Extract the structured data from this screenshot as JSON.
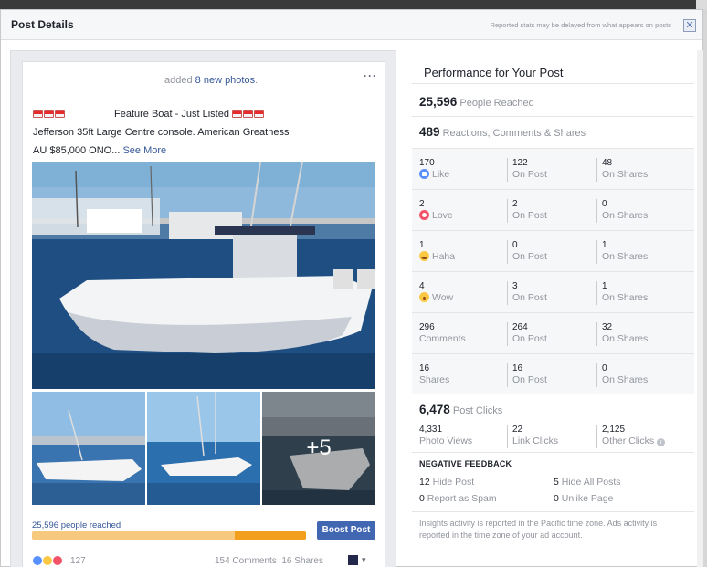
{
  "dialog": {
    "title": "Post Details",
    "header_note": "Reported stats may be delayed from what appears on posts",
    "close_glyph": "✕"
  },
  "post": {
    "added_prefix": "added ",
    "added_link": "8 new photos",
    "added_suffix": ".",
    "more_glyph": "···",
    "headline": "Feature Boat - Just Listed",
    "description": "Jefferson 35ft Large Centre console. American Greatness",
    "price": "AU $85,000 ONO",
    "ellipsis": "...",
    "see_more": "See More",
    "extra_photos": "+5",
    "reach_text": "25,596 people reached",
    "reach_fraction": 0.74,
    "boost_label": "Boost Post",
    "reactions_count": "127",
    "comments": "154 Comments",
    "shares": "16 Shares",
    "dropdown_glyph": "▾"
  },
  "performance": {
    "title": "Performance for Your Post",
    "reached_value": "25,596",
    "reached_label": "People Reached",
    "engagement_value": "489",
    "engagement_label": "Reactions, Comments & Shares",
    "rows": [
      {
        "total": "170",
        "label": "Like",
        "icon": "like",
        "on_post": "122",
        "on_post_label": "On Post",
        "on_shares": "48",
        "on_shares_label": "On Shares"
      },
      {
        "total": "2",
        "label": "Love",
        "icon": "love",
        "on_post": "2",
        "on_post_label": "On Post",
        "on_shares": "0",
        "on_shares_label": "On Shares"
      },
      {
        "total": "1",
        "label": "Haha",
        "icon": "haha",
        "on_post": "0",
        "on_post_label": "On Post",
        "on_shares": "1",
        "on_shares_label": "On Shares"
      },
      {
        "total": "4",
        "label": "Wow",
        "icon": "wow",
        "on_post": "3",
        "on_post_label": "On Post",
        "on_shares": "1",
        "on_shares_label": "On Shares"
      },
      {
        "total": "296",
        "label": "Comments",
        "icon": "",
        "on_post": "264",
        "on_post_label": "On Post",
        "on_shares": "32",
        "on_shares_label": "On Shares"
      },
      {
        "total": "16",
        "label": "Shares",
        "icon": "",
        "on_post": "16",
        "on_post_label": "On Post",
        "on_shares": "0",
        "on_shares_label": "On Shares"
      }
    ],
    "clicks_value": "6,478",
    "clicks_label": "Post Clicks",
    "photo_views": "4,331",
    "photo_views_label": "Photo Views",
    "link_clicks": "22",
    "link_clicks_label": "Link Clicks",
    "other_clicks": "2,125",
    "other_clicks_label": "Other Clicks",
    "info_glyph": "i",
    "negative": {
      "heading": "NEGATIVE FEEDBACK",
      "hide_post": "12",
      "hide_post_label": "Hide Post",
      "hide_all": "5",
      "hide_all_label": "Hide All Posts",
      "spam": "0",
      "spam_label": "Report as Spam",
      "unlike": "0",
      "unlike_label": "Unlike Page"
    },
    "footnote": "Insights activity is reported in the Pacific time zone. Ads activity is reported in the time zone of your ad account."
  },
  "colors": {
    "link": "#365899",
    "boost": "#4267b2",
    "reach_bar": "#f19f1c"
  }
}
